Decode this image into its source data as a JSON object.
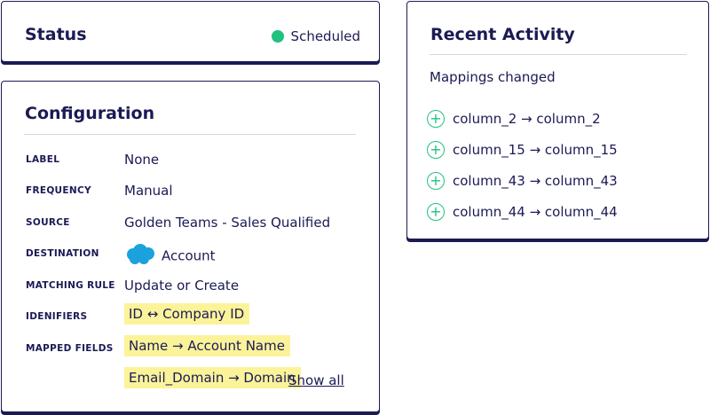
{
  "status": {
    "title": "Status",
    "state": "Scheduled",
    "state_color": "#21c180"
  },
  "configuration": {
    "title": "Configuration",
    "rows": [
      {
        "label": "LABEL",
        "value": "None"
      },
      {
        "label": "FREQUENCY",
        "value": "Manual"
      },
      {
        "label": "SOURCE",
        "value": "Golden Teams - Sales Qualified"
      },
      {
        "label": "DESTINATION",
        "value": "Account",
        "icon": "salesforce-cloud-icon"
      },
      {
        "label": "MATCHING RULE",
        "value": "Update or Create"
      },
      {
        "label": "IDENIFIERS",
        "value": "ID ↔ Company ID"
      },
      {
        "label": "MAPPED FIELDS",
        "value": "Name → Account Name"
      }
    ],
    "extra_mapped_field": "Email_Domain → Domain",
    "show_all_label": "Show all",
    "highlight_color": "#fbf39a"
  },
  "activity": {
    "title": "Recent Activity",
    "subtitle": "Mappings changed",
    "items": [
      {
        "text": "column_2 → column_2",
        "icon": "plus-circle-icon"
      },
      {
        "text": "column_15 → column_15",
        "icon": "plus-circle-icon"
      },
      {
        "text": "column_43 → column_43",
        "icon": "plus-circle-icon"
      },
      {
        "text": "column_44 → column_44",
        "icon": "plus-circle-icon"
      }
    ]
  }
}
